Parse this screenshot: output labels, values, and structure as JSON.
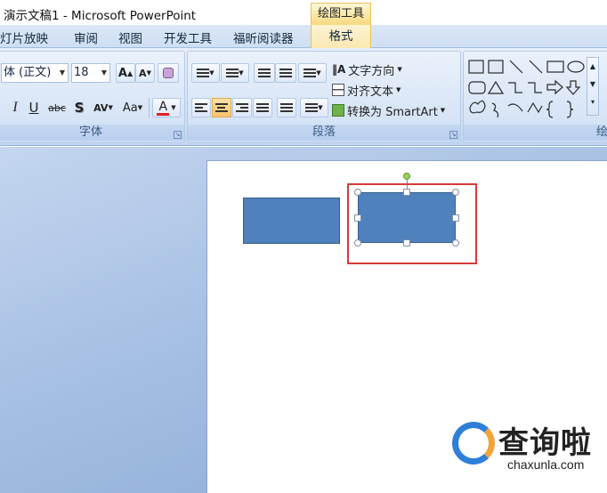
{
  "window": {
    "title": "演示文稿1 - Microsoft PowerPoint"
  },
  "context_tab": {
    "header": "绘图工具",
    "tab_label": "格式"
  },
  "tabs": [
    "灯片放映",
    "审阅",
    "视图",
    "开发工具",
    "福昕阅读器"
  ],
  "font_group": {
    "label": "字体",
    "font_name": "体 (正文)",
    "font_size": "18",
    "grow_label": "A",
    "shrink_label": "A",
    "italic": "I",
    "underline": "U",
    "strike": "abc",
    "shadow": "S",
    "spacing": "AV",
    "case": "Aa",
    "color_letter": "A",
    "font_color": "#e02020"
  },
  "paragraph_group": {
    "label": "段落",
    "text_direction": "文字方向",
    "align_text": "对齐文本",
    "convert_smartart": "转换为 SmartArt",
    "active_alignment": "center"
  },
  "drawing_group": {
    "label_partial": "绘"
  },
  "watermark": {
    "brand_cn": "查询啦",
    "domain": "chaxunla.com"
  },
  "colors": {
    "shape_fill": "#4f81bd",
    "shape_border": "#385d8a",
    "highlight": "#d83a3a",
    "context_accent": "#f7d97e"
  }
}
